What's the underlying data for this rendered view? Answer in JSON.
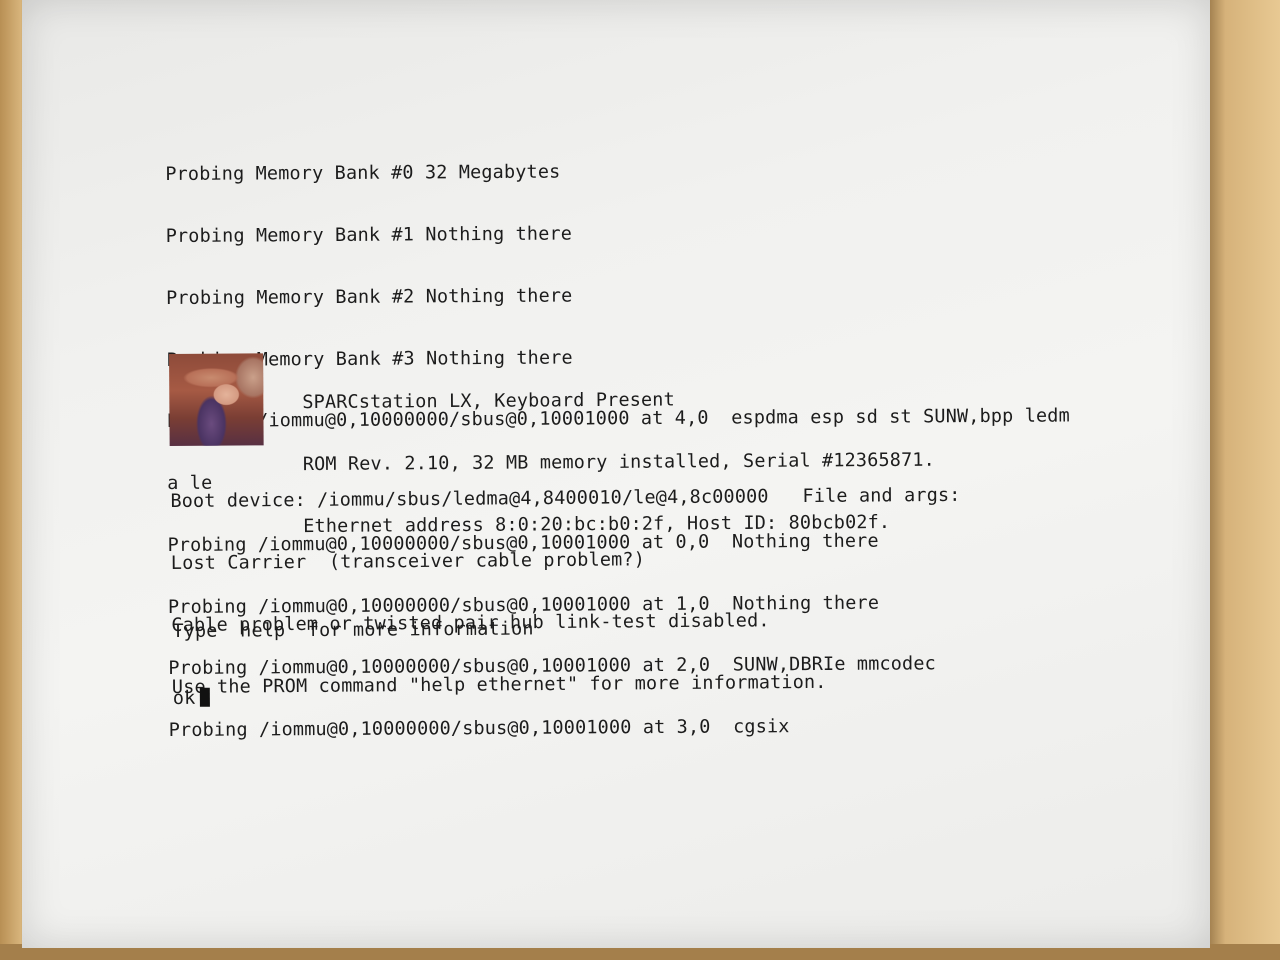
{
  "console": {
    "probe_lines": [
      "Probing Memory Bank #0 32 Megabytes",
      "Probing Memory Bank #1 Nothing there",
      "Probing Memory Bank #2 Nothing there",
      "Probing Memory Bank #3 Nothing there",
      "Probing /iommu@0,10000000/sbus@0,10001000 at 4,0  espdma esp sd st SUNW,bpp ledm",
      "a le",
      "Probing /iommu@0,10000000/sbus@0,10001000 at 0,0  Nothing there",
      "Probing /iommu@0,10000000/sbus@0,10001000 at 1,0  Nothing there",
      "Probing /iommu@0,10000000/sbus@0,10001000 at 2,0  SUNW,DBRIe mmcodec",
      "Probing /iommu@0,10000000/sbus@0,10001000 at 3,0  cgsix"
    ],
    "banner": {
      "logo_icon": "lena-portrait-icon",
      "lines": [
        "SPARCstation LX, Keyboard Present",
        "ROM Rev. 2.10, 32 MB memory installed, Serial #12365871.",
        "Ethernet address 8:0:20:bc:b0:2f, Host ID: 80bcb02f."
      ]
    },
    "boot_lines": [
      "Boot device: /iommu/sbus/ledma@4,8400010/le@4,8c00000   File and args:",
      "Lost Carrier  (transceiver cable problem?)",
      "Cable problem or twisted pair hub link-test disabled.",
      "Use the PROM command \"help ethernet\" for more information."
    ],
    "help_line": "Type  help  for more information",
    "prompt": "ok"
  },
  "colors": {
    "screen_background": "#f1f1ef",
    "text": "#1c1c1c",
    "bezel": "#cfa86a"
  }
}
